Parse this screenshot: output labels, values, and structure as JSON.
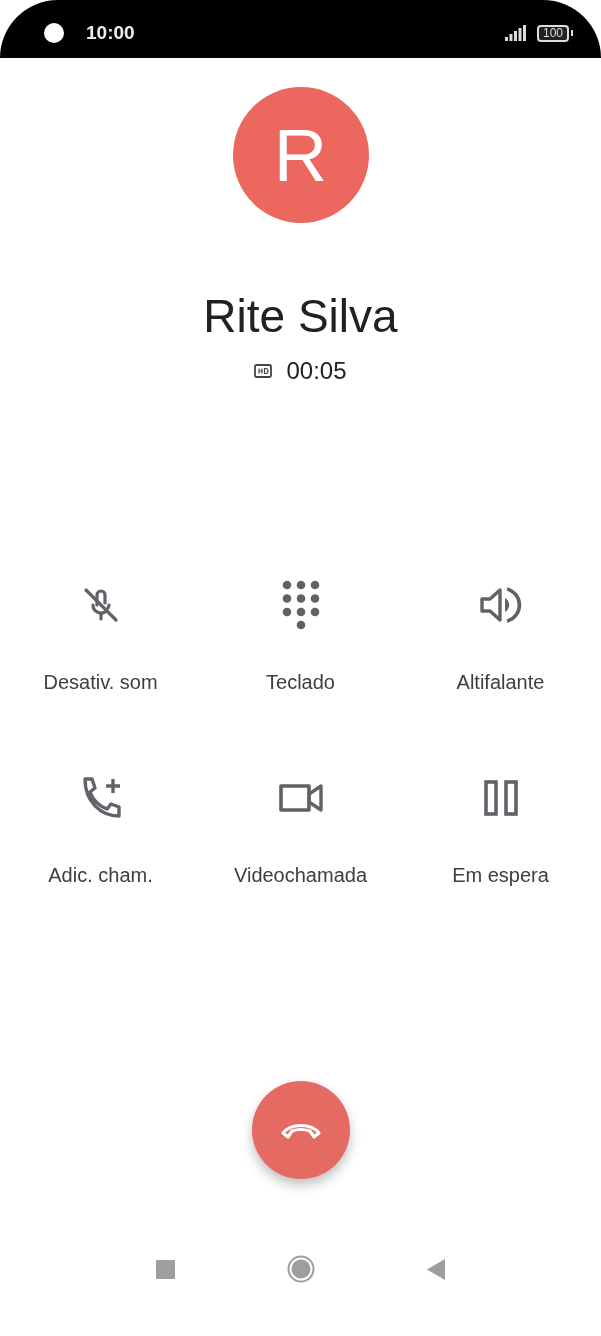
{
  "status_bar": {
    "time": "10:00",
    "battery": "100"
  },
  "contact": {
    "initial": "R",
    "name": "Rite Silva",
    "hd": true,
    "duration": "00:05"
  },
  "actions": [
    {
      "kind": "mute",
      "label": "Desativ. som"
    },
    {
      "kind": "keypad",
      "label": "Teclado"
    },
    {
      "kind": "speaker",
      "label": "Altifalante"
    },
    {
      "kind": "add_call",
      "label": "Adic. cham."
    },
    {
      "kind": "video",
      "label": "Videochamada"
    },
    {
      "kind": "hold",
      "label": "Em espera"
    }
  ]
}
